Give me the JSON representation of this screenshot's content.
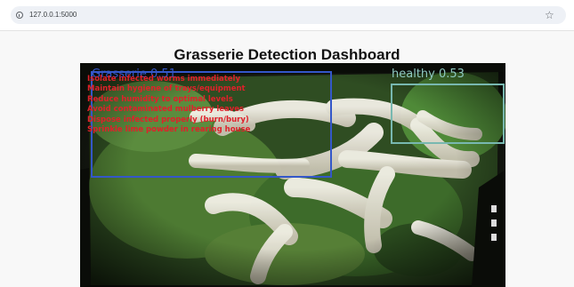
{
  "browser": {
    "url": "127.0.0.1:5000",
    "icons": {
      "site_info": "info-icon",
      "bookmark": "star-icon"
    }
  },
  "page": {
    "title": "Grasserie Detection Dashboard"
  },
  "detections": [
    {
      "label": "Grasserie 0.51",
      "color": "#3457c9"
    },
    {
      "label": "healthy 0.53",
      "color": "#78b8b0"
    }
  ],
  "recommendations": {
    "color": "#e0202a",
    "items": [
      "Isolate infected worms immediately",
      "Maintain hygiene of trays/equipment",
      "Reduce humidity to optimal levels",
      "Avoid contaminated mulberry leaves",
      "Dispose infected properly (burn/bury)",
      "Sprinkle lime powder in rearing house"
    ]
  }
}
